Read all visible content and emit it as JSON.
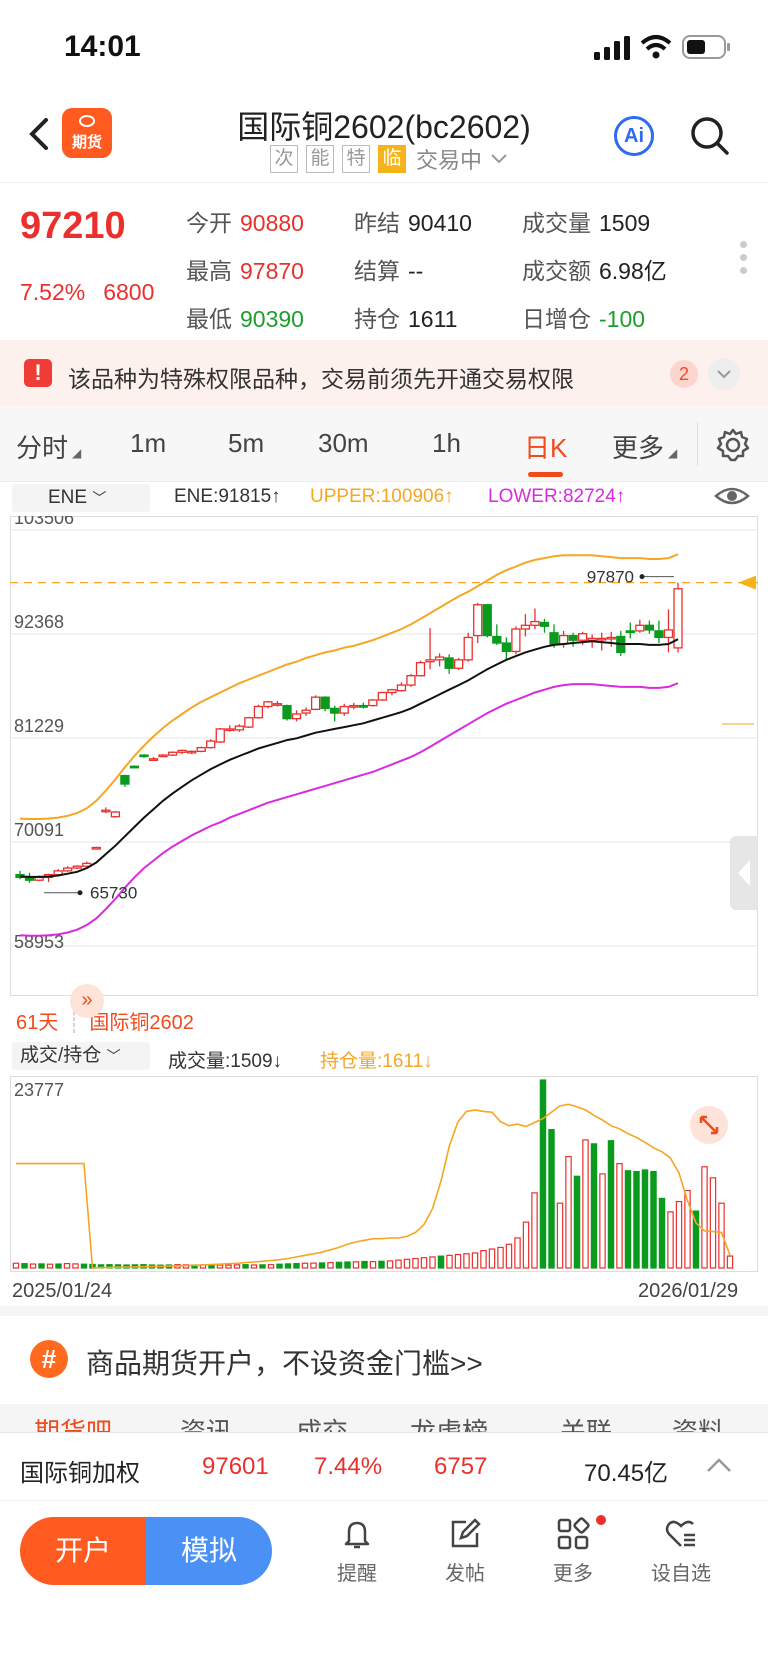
{
  "status": {
    "time": "14:01"
  },
  "header": {
    "logo_label": "期货",
    "title": "国际铜2602(bc2602)",
    "tags": [
      "次",
      "能",
      "特",
      "临"
    ],
    "trading_status": "交易中",
    "ai_label": "Ai"
  },
  "quote": {
    "price": "97210",
    "change_pct": "7.52%",
    "change_abs": "6800",
    "rows": [
      [
        {
          "k": "今开",
          "v": "90880",
          "c": "red"
        },
        {
          "k": "昨结",
          "v": "90410",
          "c": ""
        },
        {
          "k": "成交量",
          "v": "1509",
          "c": ""
        }
      ],
      [
        {
          "k": "最高",
          "v": "97870",
          "c": "red"
        },
        {
          "k": "结算",
          "v": "--",
          "c": ""
        },
        {
          "k": "成交额",
          "v": "6.98亿",
          "c": ""
        }
      ],
      [
        {
          "k": "最低",
          "v": "90390",
          "c": "green"
        },
        {
          "k": "持仓",
          "v": "1611",
          "c": ""
        },
        {
          "k": "日增仓",
          "v": "-100",
          "c": "green"
        }
      ]
    ]
  },
  "notice": {
    "text": "该品种为特殊权限品种，交易前须先开通交易权限",
    "badge": "2"
  },
  "tabs": [
    {
      "label": "分时",
      "active": false
    },
    {
      "label": "1m",
      "active": false
    },
    {
      "label": "5m",
      "active": false
    },
    {
      "label": "30m",
      "active": false
    },
    {
      "label": "1h",
      "active": false
    },
    {
      "label": "日K",
      "active": true
    },
    {
      "label": "更多",
      "active": false
    }
  ],
  "legend": {
    "indicator": "ENE",
    "ene": "ENE:91815↑",
    "upper": "UPPER:100906↑",
    "lower": "LOWER:82724↑"
  },
  "colors": {
    "up": "#e9302d",
    "down": "#0a9b1e",
    "upper": "#f6a623",
    "lower": "#d92ae0",
    "ene": "#111111",
    "accent": "#ef4b1d"
  },
  "chart_data": [
    {
      "type": "candlestick",
      "y_ticks": [
        "103506",
        "92368",
        "81229",
        "70091",
        "58953"
      ],
      "ylim": [
        58953,
        103506
      ],
      "max_label": "97870",
      "min_label": "65730",
      "days_label": "61天",
      "contract_label": "国际铜2602",
      "candles": [
        [
          66600,
          67000,
          66100,
          66300
        ],
        [
          66300,
          66800,
          65730,
          66000
        ],
        [
          66000,
          66500,
          65900,
          66300
        ],
        [
          66300,
          66700,
          65800,
          66600
        ],
        [
          66600,
          67200,
          66500,
          67000
        ],
        [
          67000,
          67500,
          66900,
          67300
        ],
        [
          67300,
          67600,
          67200,
          67500
        ],
        [
          67500,
          68000,
          67400,
          67800
        ],
        [
          69500,
          69600,
          69300,
          69500
        ],
        [
          73500,
          73800,
          73200,
          73500
        ],
        [
          72800,
          73400,
          72700,
          73300
        ],
        [
          77200,
          77300,
          76000,
          76300
        ],
        [
          78200,
          78300,
          78000,
          78100
        ],
        [
          79400,
          79500,
          79100,
          79300
        ],
        [
          79000,
          79200,
          78800,
          79000
        ],
        [
          79300,
          79500,
          79200,
          79400
        ],
        [
          79400,
          79800,
          79300,
          79700
        ],
        [
          79700,
          80000,
          79500,
          79900
        ],
        [
          79700,
          79900,
          79500,
          79800
        ],
        [
          79800,
          80300,
          79700,
          80200
        ],
        [
          80200,
          81100,
          80100,
          80900
        ],
        [
          80800,
          82300,
          80700,
          82200
        ],
        [
          82200,
          82600,
          81900,
          82200
        ],
        [
          82100,
          82700,
          81900,
          82500
        ],
        [
          82400,
          83500,
          82300,
          83400
        ],
        [
          83400,
          84800,
          83300,
          84600
        ],
        [
          84600,
          85200,
          84400,
          85100
        ],
        [
          84900,
          85200,
          84600,
          84900
        ],
        [
          84700,
          84800,
          83100,
          83300
        ],
        [
          83300,
          84200,
          83000,
          83800
        ],
        [
          83900,
          84500,
          83600,
          84200
        ],
        [
          84300,
          85800,
          84200,
          85600
        ],
        [
          85600,
          85700,
          84100,
          84400
        ],
        [
          84400,
          84700,
          83000,
          83900
        ],
        [
          83900,
          84900,
          83600,
          84600
        ],
        [
          84600,
          85000,
          84300,
          84700
        ],
        [
          84700,
          85000,
          84400,
          84600
        ],
        [
          84700,
          85400,
          84600,
          85300
        ],
        [
          85300,
          86200,
          85200,
          86100
        ],
        [
          86100,
          86500,
          85800,
          86400
        ],
        [
          86300,
          87200,
          86200,
          86900
        ],
        [
          86900,
          88100,
          86700,
          87900
        ],
        [
          87900,
          89500,
          87800,
          89300
        ],
        [
          89400,
          93000,
          88600,
          89600
        ],
        [
          89600,
          90300,
          88900,
          89900
        ],
        [
          89800,
          90200,
          88100,
          88700
        ],
        [
          88700,
          89800,
          88500,
          89600
        ],
        [
          89600,
          92500,
          89400,
          92000
        ],
        [
          92200,
          95700,
          91400,
          95500
        ],
        [
          95500,
          95600,
          92000,
          92200
        ],
        [
          92100,
          93400,
          91200,
          91400
        ],
        [
          91400,
          92000,
          89600,
          90500
        ],
        [
          90500,
          93200,
          90200,
          92900
        ],
        [
          92900,
          94500,
          92100,
          93300
        ],
        [
          93300,
          95100,
          92900,
          93700
        ],
        [
          93600,
          94000,
          92500,
          93200
        ],
        [
          92500,
          93400,
          90900,
          91300
        ],
        [
          91300,
          92700,
          90900,
          92200
        ],
        [
          92200,
          92500,
          91000,
          91700
        ],
        [
          91700,
          92600,
          91200,
          92400
        ],
        [
          91700,
          92300,
          90900,
          91900
        ],
        [
          91900,
          92500,
          90600,
          91900
        ],
        [
          91900,
          92600,
          91000,
          92000
        ],
        [
          92100,
          92700,
          90000,
          90400
        ],
        [
          92700,
          93600,
          91900,
          92600
        ],
        [
          92700,
          93900,
          92500,
          93300
        ],
        [
          93300,
          93800,
          92400,
          92800
        ],
        [
          92700,
          93800,
          91400,
          92000
        ],
        [
          92000,
          95000,
          90400,
          92800
        ],
        [
          90880,
          97870,
          90390,
          97210
        ]
      ],
      "ene": [
        66400,
        66350,
        66350,
        66400,
        66500,
        66700,
        66900,
        67300,
        67900,
        68800,
        69700,
        70700,
        71700,
        72700,
        73600,
        74500,
        75300,
        76000,
        76700,
        77300,
        77900,
        78400,
        78900,
        79300,
        79700,
        80100,
        80400,
        80700,
        81000,
        81200,
        81500,
        81800,
        82000,
        82200,
        82400,
        82600,
        82800,
        83100,
        83400,
        83700,
        84000,
        84400,
        84900,
        85400,
        85900,
        86400,
        86900,
        87400,
        88000,
        88600,
        89100,
        89600,
        90000,
        90400,
        90700,
        91000,
        91200,
        91300,
        91400,
        91500,
        91600,
        91500,
        91400,
        91300,
        91300,
        91300,
        91200,
        91200,
        91300,
        91815
      ],
      "upper": [
        72600,
        72550,
        72550,
        72600,
        72700,
        72900,
        73200,
        73700,
        74500,
        75600,
        76800,
        78100,
        79300,
        80400,
        81400,
        82300,
        83100,
        83800,
        84500,
        85100,
        85600,
        86100,
        86600,
        87100,
        87500,
        87900,
        88300,
        88700,
        89100,
        89400,
        89800,
        90100,
        90400,
        90600,
        90900,
        91100,
        91400,
        91700,
        92100,
        92500,
        92900,
        93400,
        94000,
        94600,
        95200,
        95800,
        96400,
        96900,
        97500,
        98100,
        98700,
        99200,
        99600,
        100000,
        100300,
        100500,
        100700,
        100800,
        100800,
        100800,
        100800,
        100700,
        100600,
        100500,
        100500,
        100500,
        100400,
        100400,
        100500,
        100906
      ],
      "lower": [
        60100,
        60050,
        60050,
        60100,
        60200,
        60400,
        60700,
        61200,
        61900,
        62900,
        64000,
        65200,
        66300,
        67300,
        68100,
        68900,
        69600,
        70200,
        70800,
        71300,
        71800,
        72200,
        72700,
        73100,
        73500,
        73900,
        74300,
        74600,
        74900,
        75200,
        75500,
        75800,
        76100,
        76400,
        76700,
        77000,
        77300,
        77600,
        78000,
        78400,
        78800,
        79200,
        79700,
        80300,
        80900,
        81500,
        82100,
        82700,
        83300,
        83900,
        84400,
        84900,
        85300,
        85700,
        86100,
        86400,
        86700,
        86900,
        87000,
        87000,
        87000,
        86900,
        86800,
        86700,
        86700,
        86700,
        86600,
        86600,
        86700,
        87100
      ]
    },
    {
      "type": "bar",
      "title": "成交/持仓",
      "volume_label": "成交量:1509↓",
      "oi_label": "持仓量:1611↓",
      "y_ticks": [
        "23777"
      ],
      "ylim": [
        0,
        23777
      ],
      "x_start": "2025/01/24",
      "x_end": "2026/01/29",
      "volume": [
        600,
        550,
        500,
        520,
        480,
        500,
        560,
        520,
        480,
        450,
        400,
        420,
        400,
        380,
        400,
        420,
        380,
        360,
        380,
        420,
        400,
        380,
        400,
        420,
        380,
        360,
        400,
        420,
        380,
        400,
        420,
        480,
        520,
        560,
        600,
        620,
        640,
        680,
        720,
        760,
        780,
        820,
        800,
        850,
        900,
        1000,
        1100,
        1200,
        1300,
        1400,
        1500,
        1600,
        1700,
        1800,
        1900,
        2200,
        2400,
        2600,
        3000,
        3800,
        5800,
        9500,
        23777,
        17500,
        8200,
        14100,
        11600,
        16200,
        15700,
        11900,
        16100,
        13200,
        12300,
        12200,
        12400,
        12200,
        8800,
        7100,
        8400,
        9800,
        7200,
        12800,
        11400,
        8200,
        1509
      ],
      "volume_up": [
        true,
        false,
        true,
        false,
        true,
        false,
        true,
        true,
        false,
        false,
        false,
        false,
        false,
        false,
        false,
        false,
        false,
        false,
        false,
        true,
        true,
        false,
        true,
        false,
        true,
        true,
        true,
        false,
        true,
        false,
        true,
        false,
        false,
        false,
        true,
        true,
        false,
        true,
        false,
        false,
        true,
        false,
        true,
        false,
        true,
        true,
        true,
        true,
        true,
        true,
        false,
        true,
        true,
        true,
        true,
        true,
        true,
        true,
        true,
        true,
        true,
        true,
        false,
        false,
        true,
        true,
        false,
        true,
        false,
        true,
        false,
        true,
        false,
        false,
        false,
        false,
        false,
        true,
        true,
        true,
        false,
        true,
        true,
        true,
        true
      ],
      "open_interest": [
        13200,
        13200,
        13200,
        13200,
        13200,
        13200,
        13200,
        13200,
        13200,
        0,
        50,
        80,
        100,
        120,
        140,
        160,
        180,
        200,
        230,
        260,
        300,
        340,
        380,
        430,
        480,
        540,
        600,
        680,
        760,
        850,
        950,
        1050,
        1200,
        1400,
        1600,
        1800,
        2000,
        2300,
        2600,
        3000,
        3300,
        3500,
        3700,
        3700,
        3800,
        3800,
        4000,
        4500,
        5500,
        7500,
        11000,
        15500,
        18500,
        19800,
        20000,
        19800,
        19700,
        18500,
        18000,
        18200,
        17900,
        18400,
        18900,
        19700,
        20500,
        20700,
        20400,
        20000,
        19300,
        18700,
        18000,
        17600,
        17000,
        16500,
        15900,
        15200,
        14700,
        13900,
        12000,
        8500,
        5700,
        4700,
        4600,
        4500,
        1611
      ],
      "open_interest_max": 23777
    }
  ],
  "promo": {
    "text": "商品期货开户，不设资金门槛>>"
  },
  "hidden_tabs": [
    "期货吧",
    "资讯",
    "成交",
    "龙虎榜",
    "关联",
    "资料"
  ],
  "weighted": {
    "name": "国际铜加权",
    "price": "97601",
    "pct": "7.44%",
    "chg": "6757",
    "amount": "70.45亿"
  },
  "bottom": {
    "open": "开户",
    "sim": "模拟",
    "nav": [
      "提醒",
      "发帖",
      "更多",
      "设自选"
    ]
  }
}
